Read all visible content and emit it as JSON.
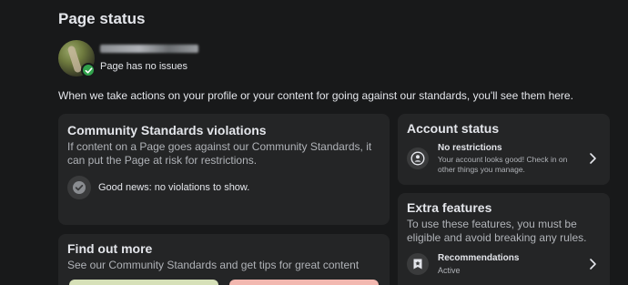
{
  "page": {
    "title": "Page status",
    "intro": "When we take actions on your profile or your content for going against our standards, you'll see them here."
  },
  "profile": {
    "status": "Page has no issues"
  },
  "community_standards": {
    "title": "Community Standards violations",
    "description": "If content on a Page goes against our Community Standards, it can put the Page at risk for restrictions.",
    "good_news": "Good news: no violations to show.",
    "icon": "check-circle-icon"
  },
  "find_out_more": {
    "title": "Find out more",
    "description": "See our Community Standards and get tips for great content"
  },
  "account_status": {
    "title": "Account status",
    "item_title": "No restrictions",
    "item_desc": "Your account looks good! Check in on other things you manage.",
    "icon": "user-shield-icon"
  },
  "extra_features": {
    "title": "Extra features",
    "description": "To use these features, you must be eligible and avoid breaking any rules.",
    "recommendations_label": "Recommendations",
    "recommendations_status": "Active",
    "icon": "recommendations-icon"
  },
  "colors": {
    "background": "#18191a",
    "card": "#242526",
    "icon_circle": "#3a3b3c",
    "success_green": "#31a24c",
    "primary_text": "#e4e6eb",
    "secondary_text": "#b0b3b8"
  }
}
